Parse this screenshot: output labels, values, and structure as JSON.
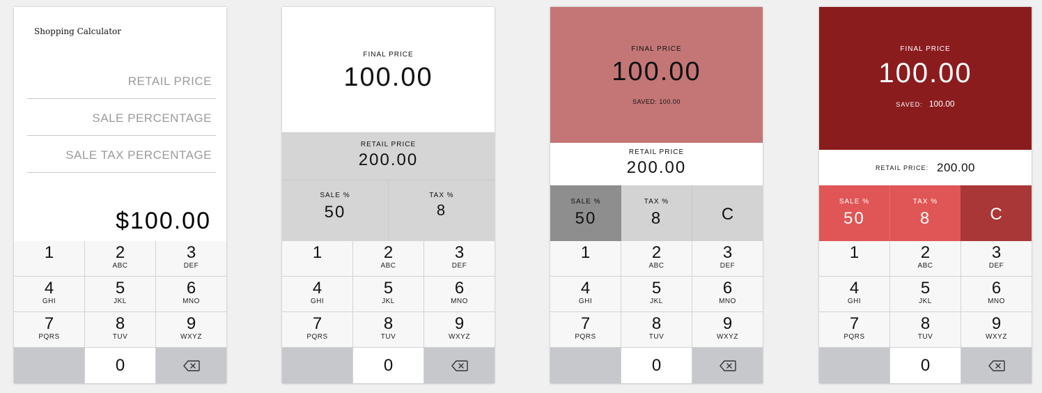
{
  "screen1": {
    "title": "Shopping Calculator",
    "fields": [
      "RETAIL PRICE",
      "SALE PERCENTAGE",
      "SALE TAX PERCENTAGE"
    ],
    "total": "$100.00"
  },
  "screen2": {
    "final_label": "FINAL PRICE",
    "final_value": "100.00",
    "retail_label": "RETAIL PRICE",
    "retail_value": "200.00",
    "sale_label": "SALE %",
    "sale_value": "50",
    "tax_label": "TAX %",
    "tax_value": "8"
  },
  "screen3": {
    "final_label": "FINAL PRICE",
    "final_value": "100.00",
    "saved_label": "SAVED: 100.00",
    "retail_label": "RETAIL PRICE",
    "retail_value": "200.00",
    "sale_label": "SALE %",
    "sale_value": "50",
    "tax_label": "TAX %",
    "tax_value": "8",
    "clear_label": "C",
    "colors": {
      "header": "#c47676",
      "sale_cell": "#8e8e8e",
      "tax_cell": "#d3d3d3",
      "clear_cell": "#d3d3d3"
    }
  },
  "screen4": {
    "final_label": "FINAL PRICE",
    "final_value": "100.00",
    "saved_label": "SAVED:",
    "saved_value": "100.00",
    "retail_label": "RETAIL PRICE:",
    "retail_value": "200.00",
    "sale_label": "SALE %",
    "sale_value": "50",
    "tax_label": "TAX %",
    "tax_value": "8",
    "clear_label": "C",
    "colors": {
      "header": "#8b1c1e",
      "sale_cell": "#e05555",
      "tax_cell": "#e05555",
      "clear_cell": "#a93737"
    }
  },
  "keypad": {
    "keys": [
      {
        "digit": "1",
        "letters": ""
      },
      {
        "digit": "2",
        "letters": "ABC"
      },
      {
        "digit": "3",
        "letters": "DEF"
      },
      {
        "digit": "4",
        "letters": "GHI"
      },
      {
        "digit": "5",
        "letters": "JKL"
      },
      {
        "digit": "6",
        "letters": "MNO"
      },
      {
        "digit": "7",
        "letters": "PQRS"
      },
      {
        "digit": "8",
        "letters": "TUV"
      },
      {
        "digit": "9",
        "letters": "WXYZ"
      }
    ],
    "zero": "0",
    "delete_icon": "backspace-icon"
  }
}
